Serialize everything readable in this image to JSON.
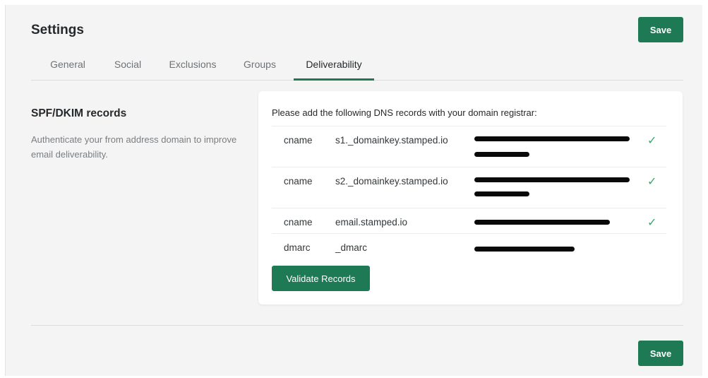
{
  "header": {
    "title": "Settings",
    "save_label": "Save"
  },
  "tabs": [
    {
      "label": "General",
      "active": false
    },
    {
      "label": "Social",
      "active": false
    },
    {
      "label": "Exclusions",
      "active": false
    },
    {
      "label": "Groups",
      "active": false
    },
    {
      "label": "Deliverability",
      "active": true
    }
  ],
  "section": {
    "title": "SPF/DKIM records",
    "description": "Authenticate your from address domain to improve email deliverability."
  },
  "dns": {
    "intro": "Please add the following DNS records with your domain registrar:",
    "records": [
      {
        "type": "cname",
        "host": "s1._domainkey.stamped.io",
        "value_redacted": true,
        "verified": true
      },
      {
        "type": "cname",
        "host": "s2._domainkey.stamped.io",
        "value_redacted": true,
        "verified": true
      },
      {
        "type": "cname",
        "host": "email.stamped.io",
        "value_redacted": true,
        "verified": true
      },
      {
        "type": "dmarc",
        "host": "_dmarc",
        "value_redacted": true,
        "verified": false
      }
    ],
    "validate_label": "Validate Records"
  },
  "footer": {
    "save_label": "Save"
  },
  "colors": {
    "accent": "#1e7a55",
    "check": "#3ea56b"
  },
  "icons": {
    "verified": "checkmark-icon"
  }
}
